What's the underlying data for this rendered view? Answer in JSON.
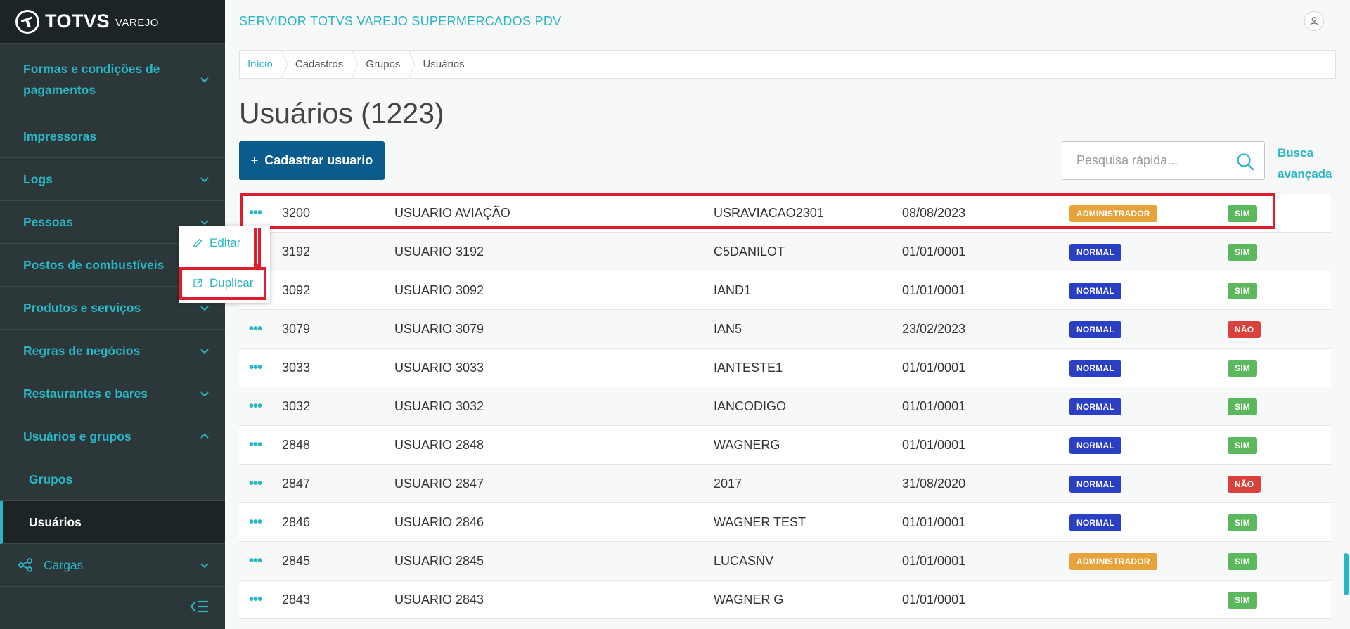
{
  "app": {
    "logo_text": "TOTVS",
    "logo_sub": "VAREJO",
    "server_title": "SERVIDOR TOTVS VAREJO SUPERMERCADOS PDV"
  },
  "sidebar": {
    "items": [
      {
        "label": "Formas e condições de pagamentos",
        "expanded": false
      },
      {
        "label": "Impressoras"
      },
      {
        "label": "Logs",
        "expanded": false
      },
      {
        "label": "Pessoas",
        "expanded": false
      },
      {
        "label": "Postos de combustíveis"
      },
      {
        "label": "Produtos e serviços",
        "expanded": false
      },
      {
        "label": "Regras de negócios",
        "expanded": false
      },
      {
        "label": "Restaurantes e bares",
        "expanded": false
      },
      {
        "label": "Usuários e grupos",
        "expanded": true
      },
      {
        "label": "Grupos"
      },
      {
        "label": "Usuários",
        "active": true
      },
      {
        "label": "Cargas",
        "expanded": false
      }
    ]
  },
  "breadcrumb": [
    "Início",
    "Cadastros",
    "Grupos",
    "Usuários"
  ],
  "page": {
    "title": "Usuários (1223)",
    "add_button": "Cadastrar usuario",
    "search_placeholder": "Pesquisa rápida...",
    "advanced_search": "Busca avançada"
  },
  "context_menu": {
    "edit": "Editar",
    "duplicate": "Duplicar"
  },
  "colors": {
    "accent": "#29b6c6",
    "primary_button": "#0b5c8d",
    "admin_badge": "#e8a23a",
    "normal_badge": "#2b3fc4",
    "yes_badge": "#5cb85c",
    "no_badge": "#d9413a",
    "highlight": "#e01e2b"
  },
  "table": {
    "rows": [
      {
        "id": "3200",
        "name": "USUARIO AVIAÇÃO",
        "login": "USRAVIACAO2301",
        "date": "08/08/2023",
        "type": "ADMINISTRADOR",
        "active": "SIM"
      },
      {
        "id": "3192",
        "name": "USUARIO 3192",
        "login": "C5DANILOT",
        "date": "01/01/0001",
        "type": "NORMAL",
        "active": "SIM"
      },
      {
        "id": "3092",
        "name": "USUARIO 3092",
        "login": "IAND1",
        "date": "01/01/0001",
        "type": "NORMAL",
        "active": "SIM"
      },
      {
        "id": "3079",
        "name": "USUARIO 3079",
        "login": "IAN5",
        "date": "23/02/2023",
        "type": "NORMAL",
        "active": "NÃO"
      },
      {
        "id": "3033",
        "name": "USUARIO 3033",
        "login": "IANTESTE1",
        "date": "01/01/0001",
        "type": "NORMAL",
        "active": "SIM"
      },
      {
        "id": "3032",
        "name": "USUARIO 3032",
        "login": "IANCODIGO",
        "date": "01/01/0001",
        "type": "NORMAL",
        "active": "SIM"
      },
      {
        "id": "2848",
        "name": "USUARIO 2848",
        "login": "WAGNERG",
        "date": "01/01/0001",
        "type": "NORMAL",
        "active": "SIM"
      },
      {
        "id": "2847",
        "name": "USUARIO 2847",
        "login": "2017",
        "date": "31/08/2020",
        "type": "NORMAL",
        "active": "NÃO"
      },
      {
        "id": "2846",
        "name": "USUARIO 2846",
        "login": "WAGNER TEST",
        "date": "01/01/0001",
        "type": "NORMAL",
        "active": "SIM"
      },
      {
        "id": "2845",
        "name": "USUARIO 2845",
        "login": "LUCASNV",
        "date": "01/01/0001",
        "type": "ADMINISTRADOR",
        "active": "SIM"
      },
      {
        "id": "2843",
        "name": "USUARIO 2843",
        "login": "WAGNER G",
        "date": "01/01/0001",
        "type": "",
        "active": "SIM"
      }
    ]
  }
}
